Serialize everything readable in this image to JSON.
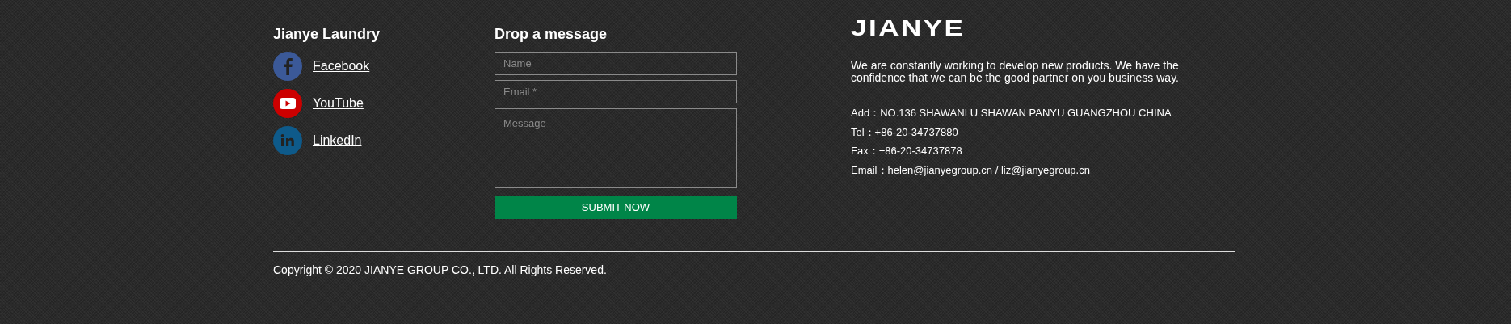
{
  "social": {
    "title": "Jianye Laundry",
    "links": [
      {
        "kind": "facebook",
        "label": "Facebook",
        "color": "#3b5998"
      },
      {
        "kind": "youtube",
        "label": "YouTube",
        "color": "#cc0000"
      },
      {
        "kind": "linkedin",
        "label": "LinkedIn",
        "color": "#0e5a8a"
      }
    ]
  },
  "form": {
    "title": "Drop a message",
    "fields": [
      {
        "kind": "input",
        "placeholder": "Name"
      },
      {
        "kind": "input",
        "placeholder": "Email *"
      },
      {
        "kind": "textarea",
        "placeholder": "Message"
      }
    ],
    "submit": "SUBMIT NOW"
  },
  "about": {
    "logo": "JIANYE",
    "text": "We are constantly working to develop new products. We have the confidence that we can be the good partner on you business way.",
    "contacts": [
      "Add：NO.136 SHAWANLU SHAWAN PANYU GUANGZHOU CHINA",
      "Tel：+86-20-34737880",
      "Fax：+86-20-34737878",
      "Email：helen@jianyegroup.cn / liz@jianyegroup.cn"
    ]
  },
  "copyright": "Copyright © 2020 JIANYE GROUP CO., LTD. All Rights Reserved."
}
